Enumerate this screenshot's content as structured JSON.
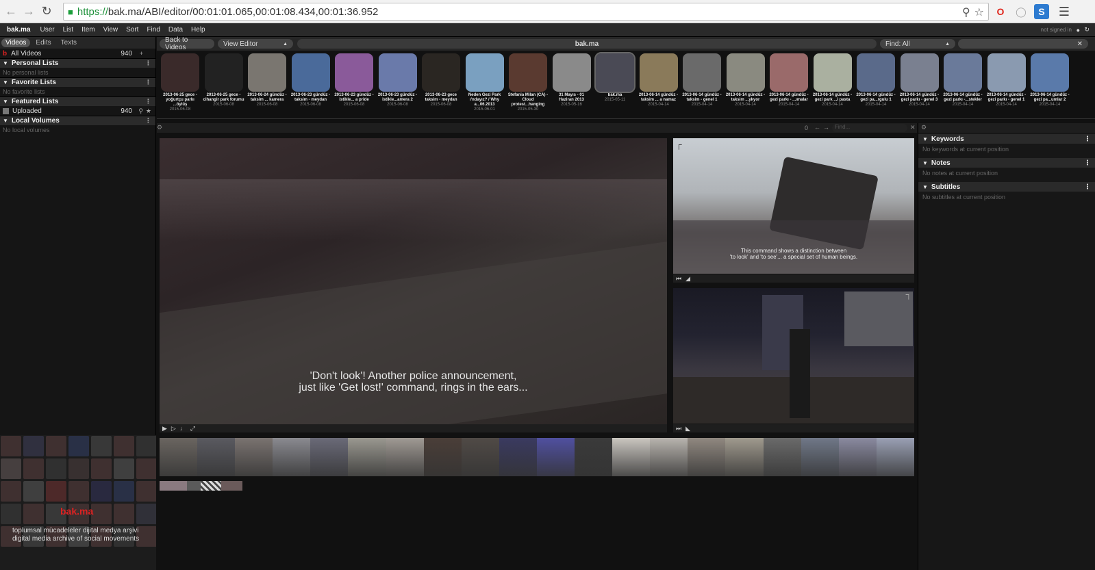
{
  "browser": {
    "url_scheme": "https://",
    "url_rest": "bak.ma/ABI/editor/00:01:01.065,00:01:08.434,00:01:36.952"
  },
  "menu": {
    "brand": "bak.ma",
    "items": [
      "User",
      "List",
      "Item",
      "View",
      "Sort",
      "Find",
      "Data",
      "Help"
    ],
    "signed_status": "not signed in"
  },
  "left_panel": {
    "tabs": [
      "Videos",
      "Edits",
      "Texts"
    ],
    "all_videos": {
      "label": "All Videos",
      "count": "940"
    },
    "sections": [
      {
        "title": "Personal Lists",
        "empty": "No personal lists"
      },
      {
        "title": "Favorite Lists",
        "empty": "No favorite lists"
      },
      {
        "title": "Featured Lists",
        "item": "Uploaded",
        "count": "940"
      },
      {
        "title": "Local Volumes",
        "empty": "No local volumes"
      }
    ],
    "logo": "bak.ma",
    "tagline_tr": "toplumsal mücadeleler dijital medya arşivi",
    "tagline_en": "digital media archive of social movements"
  },
  "toolbar": {
    "back_label": "Back to Videos",
    "view_label": "View Editor",
    "center_title": "bak.ma",
    "find_label": "Find: All"
  },
  "thumbnails": [
    {
      "title": "2013-06-25 gece - yoğurtçu parkı ...öylüş",
      "date": "2015-06-08",
      "color": "#3a2a2a"
    },
    {
      "title": "2013-06-25 gece - cihangir park forumu",
      "date": "2015-06-08",
      "color": "#222"
    },
    {
      "title": "2013-06-24 gündüz - taksim ... kamera",
      "date": "2015-06-08",
      "color": "#7a7670"
    },
    {
      "title": "2013-06-23 gündüz - taksim - meydan",
      "date": "2015-06-08",
      "color": "#4a6a9a"
    },
    {
      "title": "2013-06-23 gündüz - istikle... a pride",
      "date": "2015-06-08",
      "color": "#8a5a9a"
    },
    {
      "title": "2013-06-23 gündüz - istikle...amera 2",
      "date": "2015-06-08",
      "color": "#6a7aaa"
    },
    {
      "title": "2013-06-23 gece taksim - meydan",
      "date": "2015-06-08",
      "color": "#2a2622"
    },
    {
      "title": "Neden Gezi Park ı'ndayız? / Why a...06.2013",
      "date": "2015-06-01",
      "color": "#7aa0c0"
    },
    {
      "title": "Stefania Milan (CA) - Cloud protest...hanging",
      "date": "2015-05-30",
      "color": "#5a3a30"
    },
    {
      "title": "31 Mayıs - 01 Haziran 2013",
      "date": "2015-05-16",
      "color": "#8a8a8a"
    },
    {
      "title": "bak.ma",
      "date": "2015-05-11",
      "color": "#4a4a55"
    },
    {
      "title": "2013-06-14 gündüz - taksim ... a namaz",
      "date": "2015-04-14",
      "color": "#8a7a5a"
    },
    {
      "title": "2013-06-14 gündüz - taksim - genel 1",
      "date": "2015-04-14",
      "color": "#6a6a6a"
    },
    {
      "title": "2013-06-14 gündüz - taksim ...ykyor",
      "date": "2015-04-14",
      "color": "#8a8a80"
    },
    {
      "title": "2013-06-14 gündüz - gezi parkı - ...ımalar",
      "date": "2015-04-14",
      "color": "#9a6a6a"
    },
    {
      "title": "2013-06-14 gündüz - gezi park ...i pasta",
      "date": "2015-04-14",
      "color": "#aab0a0"
    },
    {
      "title": "2013-06-14 gündüz - gezi pa...rgulu 1",
      "date": "2015-04-14",
      "color": "#5a6a8a"
    },
    {
      "title": "2013-06-14 gündüz - gezi parkı - genel 3",
      "date": "2015-04-14",
      "color": "#7a8090"
    },
    {
      "title": "2013-06-14 gündüz - gezi parkı -...stekler",
      "date": "2015-04-14",
      "color": "#6a7a9a"
    },
    {
      "title": "2013-06-14 gündüz - gezi parkı - genel 1",
      "date": "2015-04-14",
      "color": "#8a9ab0"
    },
    {
      "title": "2013-06-14 gündüz - gezi pa...umlar 2",
      "date": "2015-04-14",
      "color": "#5a7aaa"
    }
  ],
  "editor": {
    "find_placeholder": "Find...",
    "count": "0",
    "main_subtitle_1": "'Don't look'! Another police announcement,",
    "main_subtitle_2": "just like 'Get lost!' command, rings in the ears...",
    "small_subtitle_1": "This command shows a distinction between",
    "small_subtitle_2": "'to look' and 'to see'... a special set of human beings."
  },
  "right_panel": {
    "sections": [
      {
        "title": "Keywords",
        "empty": "No keywords at current position"
      },
      {
        "title": "Notes",
        "empty": "No notes at current position"
      },
      {
        "title": "Subtitles",
        "empty": "No subtitles at current position"
      }
    ]
  },
  "timeline_colors": [
    "#6a6560",
    "#5a5a60",
    "#7a7370",
    "#8a8a90",
    "#6a6a78",
    "#9a9890",
    "#a09a94",
    "#4a3e38",
    "#504a46",
    "#3a3a60",
    "#5050a0",
    "#3a3a3a",
    "#cac6c0",
    "#b8b4ae",
    "#908880",
    "#a09a8e",
    "#6a6a6a",
    "#707888",
    "#8a8aa0",
    "#9aa0b4"
  ]
}
